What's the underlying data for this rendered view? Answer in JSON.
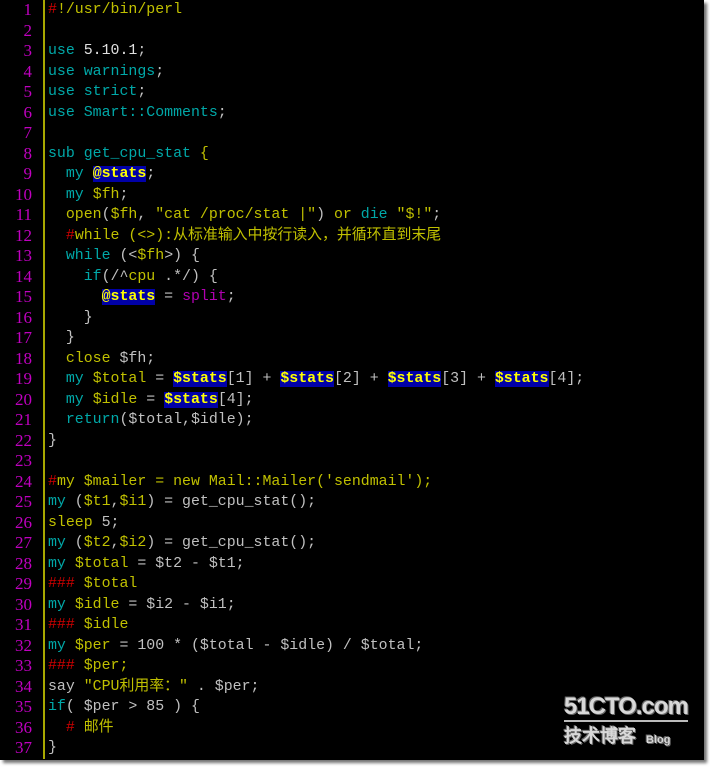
{
  "editor": {
    "language": "perl",
    "lines": [
      {
        "n": "1",
        "tokens": [
          {
            "t": "#",
            "c": "cm"
          },
          {
            "t": "!/usr/bin/perl",
            "c": "str"
          }
        ]
      },
      {
        "n": "2",
        "tokens": []
      },
      {
        "n": "3",
        "tokens": [
          {
            "t": "use",
            "c": "kw"
          },
          {
            "t": " ",
            "c": "plain"
          },
          {
            "t": "5.10.1",
            "c": "num"
          },
          {
            "t": ";",
            "c": "plain"
          }
        ]
      },
      {
        "n": "4",
        "tokens": [
          {
            "t": "use warnings",
            "c": "kw"
          },
          {
            "t": ";",
            "c": "plain"
          }
        ]
      },
      {
        "n": "5",
        "tokens": [
          {
            "t": "use strict",
            "c": "kw"
          },
          {
            "t": ";",
            "c": "plain"
          }
        ]
      },
      {
        "n": "6",
        "tokens": [
          {
            "t": "use Smart::Comments",
            "c": "kw"
          },
          {
            "t": ";",
            "c": "plain"
          }
        ]
      },
      {
        "n": "7",
        "tokens": []
      },
      {
        "n": "8",
        "tokens": [
          {
            "t": "sub get_cpu_stat",
            "c": "kw"
          },
          {
            "t": " {",
            "c": "str"
          }
        ]
      },
      {
        "n": "9",
        "tokens": [
          {
            "t": "  ",
            "c": "plain"
          },
          {
            "t": "my",
            "c": "kw"
          },
          {
            "t": " ",
            "c": "plain"
          },
          {
            "t": "@stats",
            "c": "hl"
          },
          {
            "t": ";",
            "c": "plain"
          }
        ]
      },
      {
        "n": "10",
        "tokens": [
          {
            "t": "  ",
            "c": "plain"
          },
          {
            "t": "my",
            "c": "kw"
          },
          {
            "t": " ",
            "c": "plain"
          },
          {
            "t": "$fh",
            "c": "str"
          },
          {
            "t": ";",
            "c": "plain"
          }
        ]
      },
      {
        "n": "11",
        "tokens": [
          {
            "t": "  ",
            "c": "plain"
          },
          {
            "t": "open",
            "c": "str"
          },
          {
            "t": "(",
            "c": "plain"
          },
          {
            "t": "$fh",
            "c": "str"
          },
          {
            "t": ", ",
            "c": "plain"
          },
          {
            "t": "\"cat /proc/stat |\"",
            "c": "str"
          },
          {
            "t": ") ",
            "c": "plain"
          },
          {
            "t": "or",
            "c": "str"
          },
          {
            "t": " ",
            "c": "plain"
          },
          {
            "t": "die",
            "c": "kw"
          },
          {
            "t": " ",
            "c": "plain"
          },
          {
            "t": "\"$!\"",
            "c": "str"
          },
          {
            "t": ";",
            "c": "plain"
          }
        ]
      },
      {
        "n": "12",
        "tokens": [
          {
            "t": "  ",
            "c": "plain"
          },
          {
            "t": "#",
            "c": "cm"
          },
          {
            "t": "while (<>):从标准输入中按行读入，并循环直到末尾",
            "c": "str"
          }
        ]
      },
      {
        "n": "13",
        "tokens": [
          {
            "t": "  ",
            "c": "plain"
          },
          {
            "t": "while",
            "c": "kw"
          },
          {
            "t": " (<",
            "c": "plain"
          },
          {
            "t": "$fh",
            "c": "str"
          },
          {
            "t": ">) {",
            "c": "plain"
          }
        ]
      },
      {
        "n": "14",
        "tokens": [
          {
            "t": "    ",
            "c": "plain"
          },
          {
            "t": "if",
            "c": "kw"
          },
          {
            "t": "(/^",
            "c": "plain"
          },
          {
            "t": "cpu",
            "c": "str"
          },
          {
            "t": " .*/) {",
            "c": "plain"
          }
        ]
      },
      {
        "n": "15",
        "tokens": [
          {
            "t": "      ",
            "c": "plain"
          },
          {
            "t": "@stats",
            "c": "hl"
          },
          {
            "t": " = ",
            "c": "plain"
          },
          {
            "t": "split",
            "c": "fn"
          },
          {
            "t": ";",
            "c": "plain"
          }
        ]
      },
      {
        "n": "16",
        "tokens": [
          {
            "t": "    }",
            "c": "plain"
          }
        ]
      },
      {
        "n": "17",
        "tokens": [
          {
            "t": "  }",
            "c": "plain"
          }
        ]
      },
      {
        "n": "18",
        "tokens": [
          {
            "t": "  ",
            "c": "plain"
          },
          {
            "t": "close",
            "c": "str"
          },
          {
            "t": " $fh;",
            "c": "plain"
          }
        ]
      },
      {
        "n": "19",
        "tokens": [
          {
            "t": "  ",
            "c": "plain"
          },
          {
            "t": "my",
            "c": "kw"
          },
          {
            "t": " ",
            "c": "plain"
          },
          {
            "t": "$total",
            "c": "str"
          },
          {
            "t": " = ",
            "c": "plain"
          },
          {
            "t": "$stats",
            "c": "hl"
          },
          {
            "t": "[1] + ",
            "c": "plain"
          },
          {
            "t": "$stats",
            "c": "hl"
          },
          {
            "t": "[2] + ",
            "c": "plain"
          },
          {
            "t": "$stats",
            "c": "hl"
          },
          {
            "t": "[3] + ",
            "c": "plain"
          },
          {
            "t": "$stats",
            "c": "hl"
          },
          {
            "t": "[4];",
            "c": "plain"
          }
        ]
      },
      {
        "n": "20",
        "tokens": [
          {
            "t": "  ",
            "c": "plain"
          },
          {
            "t": "my",
            "c": "kw"
          },
          {
            "t": " ",
            "c": "plain"
          },
          {
            "t": "$idle",
            "c": "str"
          },
          {
            "t": " = ",
            "c": "plain"
          },
          {
            "t": "$stats",
            "c": "hl"
          },
          {
            "t": "[4];",
            "c": "plain"
          }
        ]
      },
      {
        "n": "21",
        "tokens": [
          {
            "t": "  ",
            "c": "plain"
          },
          {
            "t": "return",
            "c": "kw"
          },
          {
            "t": "($total,$idle);",
            "c": "plain"
          }
        ]
      },
      {
        "n": "22",
        "tokens": [
          {
            "t": "}",
            "c": "plain"
          }
        ]
      },
      {
        "n": "23",
        "tokens": []
      },
      {
        "n": "24",
        "tokens": [
          {
            "t": "#",
            "c": "cm"
          },
          {
            "t": "my $mailer = new Mail::Mailer('sendmail');",
            "c": "str"
          }
        ]
      },
      {
        "n": "25",
        "tokens": [
          {
            "t": "my",
            "c": "kw"
          },
          {
            "t": " (",
            "c": "plain"
          },
          {
            "t": "$t1",
            "c": "str"
          },
          {
            "t": ",",
            "c": "plain"
          },
          {
            "t": "$i1",
            "c": "str"
          },
          {
            "t": ") = get_cpu_stat();",
            "c": "plain"
          }
        ]
      },
      {
        "n": "26",
        "tokens": [
          {
            "t": "sleep",
            "c": "str"
          },
          {
            "t": " 5;",
            "c": "plain"
          }
        ]
      },
      {
        "n": "27",
        "tokens": [
          {
            "t": "my",
            "c": "kw"
          },
          {
            "t": " (",
            "c": "plain"
          },
          {
            "t": "$t2",
            "c": "str"
          },
          {
            "t": ",",
            "c": "plain"
          },
          {
            "t": "$i2",
            "c": "str"
          },
          {
            "t": ") = get_cpu_stat();",
            "c": "plain"
          }
        ]
      },
      {
        "n": "28",
        "tokens": [
          {
            "t": "my",
            "c": "kw"
          },
          {
            "t": " ",
            "c": "plain"
          },
          {
            "t": "$total",
            "c": "str"
          },
          {
            "t": " = $t2 - $t1;",
            "c": "plain"
          }
        ]
      },
      {
        "n": "29",
        "tokens": [
          {
            "t": "###",
            "c": "cm"
          },
          {
            "t": " $total",
            "c": "str"
          }
        ]
      },
      {
        "n": "30",
        "tokens": [
          {
            "t": "my",
            "c": "kw"
          },
          {
            "t": " ",
            "c": "plain"
          },
          {
            "t": "$idle",
            "c": "str"
          },
          {
            "t": " = $i2 - $i1;",
            "c": "plain"
          }
        ]
      },
      {
        "n": "31",
        "tokens": [
          {
            "t": "###",
            "c": "cm"
          },
          {
            "t": " $idle",
            "c": "str"
          }
        ]
      },
      {
        "n": "32",
        "tokens": [
          {
            "t": "my",
            "c": "kw"
          },
          {
            "t": " ",
            "c": "plain"
          },
          {
            "t": "$per",
            "c": "str"
          },
          {
            "t": " = 100 * ($total - $idle) / $total;",
            "c": "plain"
          }
        ]
      },
      {
        "n": "33",
        "tokens": [
          {
            "t": "###",
            "c": "cm"
          },
          {
            "t": " $per;",
            "c": "str"
          }
        ]
      },
      {
        "n": "34",
        "tokens": [
          {
            "t": "say ",
            "c": "plain"
          },
          {
            "t": "\"CPU利用率：\"",
            "c": "str"
          },
          {
            "t": " . $per;",
            "c": "plain"
          }
        ]
      },
      {
        "n": "35",
        "tokens": [
          {
            "t": "if",
            "c": "kw"
          },
          {
            "t": "( $per > 85 ) {",
            "c": "plain"
          }
        ]
      },
      {
        "n": "36",
        "tokens": [
          {
            "t": "  ",
            "c": "plain"
          },
          {
            "t": "#",
            "c": "cm"
          },
          {
            "t": " 邮件",
            "c": "str"
          }
        ]
      },
      {
        "n": "37",
        "tokens": [
          {
            "t": "}",
            "c": "plain"
          }
        ]
      }
    ]
  },
  "watermark": {
    "site": "51CTO.com",
    "subtitle": "技术博客",
    "tag": "Blog"
  }
}
